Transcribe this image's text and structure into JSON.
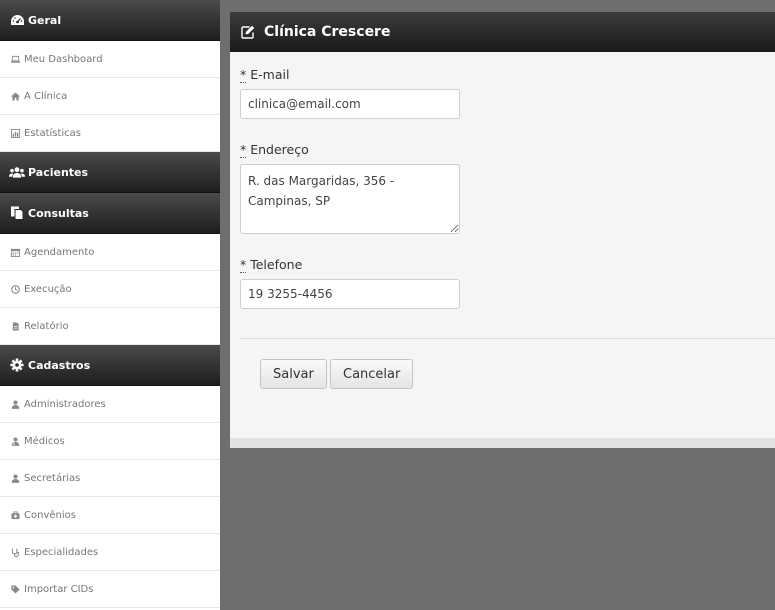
{
  "sidebar": {
    "sections": [
      {
        "title": "Geral",
        "icon": "dashboard-icon",
        "items": [
          {
            "label": "Meu Dashboard",
            "icon": "laptop-icon"
          },
          {
            "label": "A Clínica",
            "icon": "home-icon"
          },
          {
            "label": "Estatísticas",
            "icon": "bar-chart-icon"
          }
        ]
      },
      {
        "title": "Pacientes",
        "icon": "users-group-icon",
        "items": []
      },
      {
        "title": "Consultas",
        "icon": "files-icon",
        "items": [
          {
            "label": "Agendamento",
            "icon": "calendar-icon"
          },
          {
            "label": "Execução",
            "icon": "clock-icon"
          },
          {
            "label": "Relatório",
            "icon": "file-icon"
          }
        ]
      },
      {
        "title": "Cadastros",
        "icon": "gear-icon",
        "items": [
          {
            "label": "Administradores",
            "icon": "user-icon"
          },
          {
            "label": "Médicos",
            "icon": "user-md-icon"
          },
          {
            "label": "Secretárias",
            "icon": "user-icon"
          },
          {
            "label": "Convênios",
            "icon": "medkit-icon"
          },
          {
            "label": "Especialidades",
            "icon": "stethoscope-icon"
          },
          {
            "label": "Importar CIDs",
            "icon": "tag-icon"
          }
        ]
      }
    ]
  },
  "panel": {
    "title": "Clínica Crescere",
    "icon": "edit-icon",
    "form": {
      "email": {
        "required_mark": "*",
        "label": "E-mail",
        "value": "clinica@email.com"
      },
      "address": {
        "required_mark": "*",
        "label": "Endereço",
        "value": "R. das Margaridas, 356 - Campinas, SP"
      },
      "phone": {
        "required_mark": "*",
        "label": "Telefone",
        "value": "19 3255-4456"
      }
    },
    "buttons": {
      "save": "Salvar",
      "cancel": "Cancelar"
    }
  }
}
